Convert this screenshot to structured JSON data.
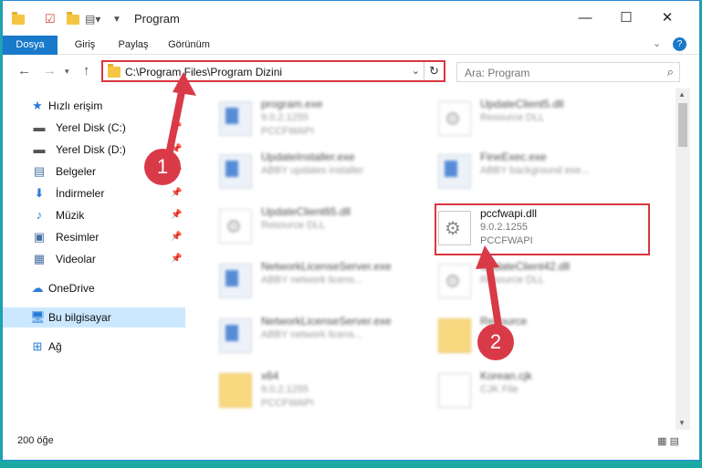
{
  "window": {
    "title": "Program"
  },
  "ribbon": {
    "tabs": [
      "Dosya",
      "Giriş",
      "Paylaş",
      "Görünüm"
    ]
  },
  "address": {
    "path": "C:\\Program Files\\Program Dizini"
  },
  "search": {
    "placeholder": "Ara: Program"
  },
  "sidebar": {
    "items": [
      {
        "label": "Hızlı erişim",
        "icon": "star-icon",
        "pinned": false
      },
      {
        "label": "Yerel Disk (C:)",
        "icon": "drive-icon",
        "pinned": true
      },
      {
        "label": "Yerel Disk (D:)",
        "icon": "drive-icon",
        "pinned": true
      },
      {
        "label": "Belgeler",
        "icon": "documents-icon",
        "pinned": true
      },
      {
        "label": "İndirmeler",
        "icon": "download-icon",
        "pinned": true
      },
      {
        "label": "Müzik",
        "icon": "music-icon",
        "pinned": true
      },
      {
        "label": "Resimler",
        "icon": "pictures-icon",
        "pinned": true
      },
      {
        "label": "Videolar",
        "icon": "videos-icon",
        "pinned": true
      },
      {
        "label": "OneDrive",
        "icon": "cloud-icon",
        "pinned": false
      },
      {
        "label": "Bu bilgisayar",
        "icon": "computer-icon",
        "pinned": false
      },
      {
        "label": "Ağ",
        "icon": "network-icon",
        "pinned": false
      }
    ]
  },
  "files": [
    {
      "name": "program.exe",
      "line2": "9.0.2.1255",
      "line3": "PCCFWAPI",
      "type": "exe"
    },
    {
      "name": "UpdateClient5.dll",
      "line2": "Resource DLL",
      "line3": "",
      "type": "dll"
    },
    {
      "name": "UpdateInstaller.exe",
      "line2": "ABBY updates installer",
      "line3": "",
      "type": "exe"
    },
    {
      "name": "FineExec.exe",
      "line2": "ABBY background exe...",
      "line3": "",
      "type": "exe"
    },
    {
      "name": "UpdateClient65.dll",
      "line2": "Resource DLL",
      "line3": "",
      "type": "dll"
    },
    {
      "name": "pccfwapi.dll",
      "line2": "9.0.2.1255",
      "line3": "PCCFWAPI",
      "type": "dll",
      "highlighted": true
    },
    {
      "name": "NetworkLicenseServer.exe",
      "line2": "ABBY network licens...",
      "line3": "",
      "type": "exe"
    },
    {
      "name": "UpdateClient42.dll",
      "line2": "Resource DLL",
      "line3": "",
      "type": "dll"
    },
    {
      "name": "NetworkLicenseServer.exe",
      "line2": "ABBY network licens...",
      "line3": "",
      "type": "exe"
    },
    {
      "name": "Resource",
      "line2": "",
      "line3": "",
      "type": "folder"
    },
    {
      "name": "x64",
      "line2": "9.0.2.1255",
      "line3": "PCCFWAPI",
      "type": "folder"
    },
    {
      "name": "Korean.cjk",
      "line2": "CJK File",
      "line3": "",
      "type": "file"
    }
  ],
  "status": {
    "count": "200 öğe"
  },
  "annotations": {
    "badge1": "1",
    "badge2": "2",
    "color": "#d93a48"
  }
}
